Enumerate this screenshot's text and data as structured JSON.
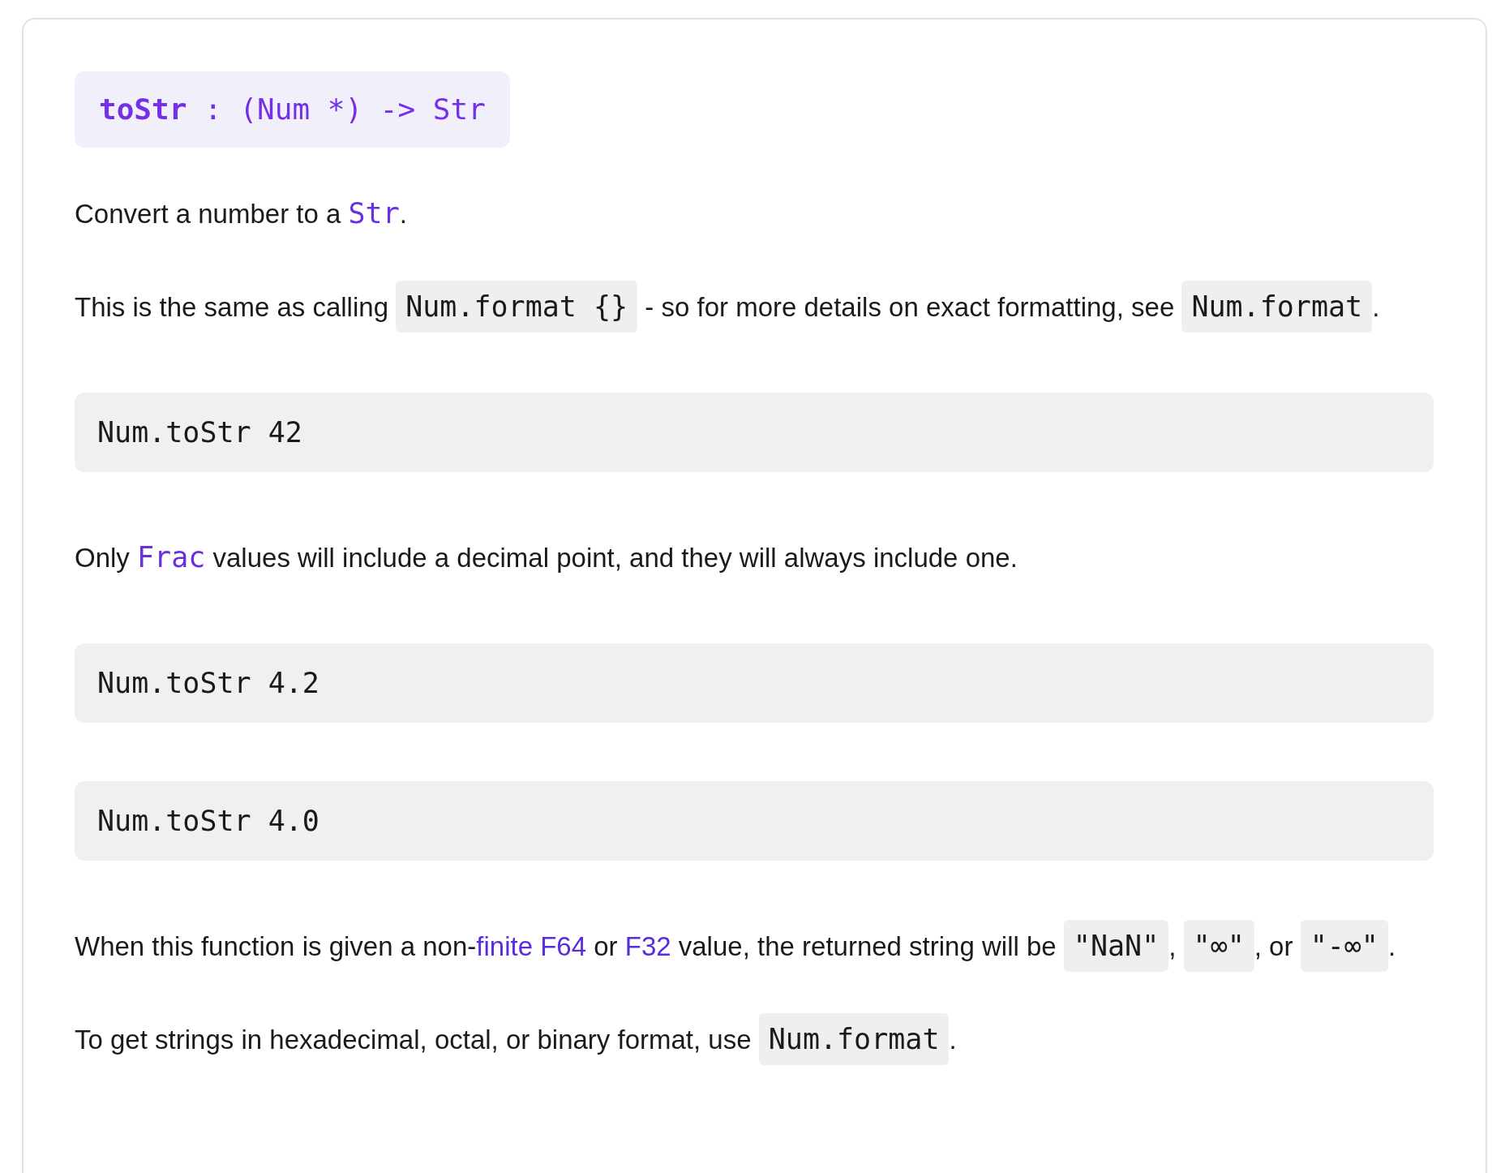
{
  "signature": {
    "name": "toStr",
    "type": ": (Num *) -> Str"
  },
  "content": [
    {
      "kind": "paragraph",
      "parts": [
        {
          "kind": "text",
          "text": "Convert a number to a "
        },
        {
          "kind": "code_link",
          "text": "Str"
        },
        {
          "kind": "text",
          "text": "."
        }
      ]
    },
    {
      "kind": "paragraph",
      "parts": [
        {
          "kind": "text",
          "text": "This is the same as calling "
        },
        {
          "kind": "code",
          "text": "Num.format {}"
        },
        {
          "kind": "text",
          "text": " - so for more details on exact formatting, see "
        },
        {
          "kind": "code",
          "text": "Num.format"
        },
        {
          "kind": "text",
          "text": "."
        }
      ]
    },
    {
      "kind": "code_block",
      "text": "Num.toStr 42"
    },
    {
      "kind": "paragraph",
      "parts": [
        {
          "kind": "text",
          "text": "Only "
        },
        {
          "kind": "code_link",
          "text": "Frac"
        },
        {
          "kind": "text",
          "text": " values will include a decimal point, and they will always include one."
        }
      ]
    },
    {
      "kind": "code_block",
      "text": "Num.toStr 4.2"
    },
    {
      "kind": "code_block",
      "text": "Num.toStr 4.0"
    },
    {
      "kind": "paragraph",
      "parts": [
        {
          "kind": "text",
          "text": "When this function is given a non-"
        },
        {
          "kind": "link",
          "text": "finite F64"
        },
        {
          "kind": "text",
          "text": " or "
        },
        {
          "kind": "link",
          "text": "F32"
        },
        {
          "kind": "text",
          "text": " value, the returned string will be "
        },
        {
          "kind": "code",
          "text": "\"NaN\""
        },
        {
          "kind": "text",
          "text": ", "
        },
        {
          "kind": "code",
          "text": "\"∞\""
        },
        {
          "kind": "text",
          "text": ", or "
        },
        {
          "kind": "code",
          "text": "\"-∞\""
        },
        {
          "kind": "text",
          "text": "."
        }
      ]
    },
    {
      "kind": "paragraph",
      "parts": [
        {
          "kind": "text",
          "text": "To get strings in hexadecimal, octal, or binary format, use "
        },
        {
          "kind": "code",
          "text": "Num.format"
        },
        {
          "kind": "text",
          "text": "."
        }
      ]
    }
  ]
}
